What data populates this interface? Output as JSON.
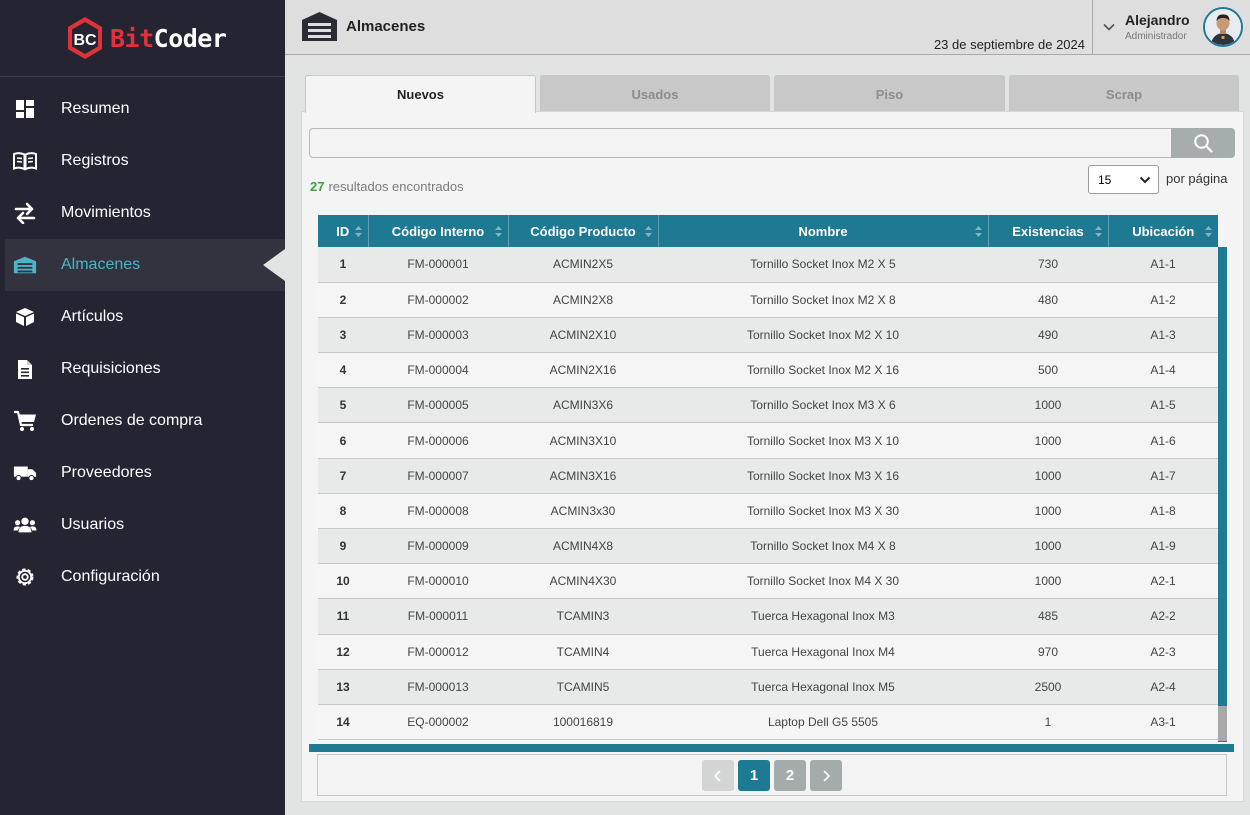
{
  "brand": {
    "part1": "Bit",
    "part2": "Coder",
    "mark": "BC"
  },
  "sidebar": {
    "items": [
      {
        "label": "Resumen",
        "icon": "dashboard-icon",
        "active": false
      },
      {
        "label": "Registros",
        "icon": "book-icon",
        "active": false
      },
      {
        "label": "Movimientos",
        "icon": "exchange-arrows-icon",
        "active": false
      },
      {
        "label": "Almacenes",
        "icon": "warehouse-icon",
        "active": true
      },
      {
        "label": "Artículos",
        "icon": "box-icon",
        "active": false
      },
      {
        "label": "Requisiciones",
        "icon": "document-icon",
        "active": false
      },
      {
        "label": "Ordenes de compra",
        "icon": "cart-icon",
        "active": false
      },
      {
        "label": "Proveedores",
        "icon": "truck-icon",
        "active": false
      },
      {
        "label": "Usuarios",
        "icon": "users-icon",
        "active": false
      },
      {
        "label": "Configuración",
        "icon": "gear-icon",
        "active": false
      }
    ]
  },
  "header": {
    "title": "Almacenes",
    "date": "23 de septiembre de 2024",
    "user": {
      "name": "Alejandro",
      "role": "Administrador"
    }
  },
  "tabs": [
    {
      "label": "Nuevos",
      "active": true
    },
    {
      "label": "Usados",
      "active": false
    },
    {
      "label": "Piso",
      "active": false
    },
    {
      "label": "Scrap",
      "active": false
    }
  ],
  "search": {
    "value": "",
    "placeholder": ""
  },
  "results": {
    "count": "27",
    "text": "resultados encontrados"
  },
  "per_page": {
    "value": "15",
    "label": "por página",
    "options": [
      "15"
    ]
  },
  "table": {
    "columns": [
      "ID",
      "Código Interno",
      "Código Producto",
      "Nombre",
      "Existencias",
      "Ubicación"
    ],
    "rows": [
      [
        "1",
        "FM-000001",
        "ACMIN2X5",
        "Tornillo Socket Inox M2 X 5",
        "730",
        "A1-1"
      ],
      [
        "2",
        "FM-000002",
        "ACMIN2X8",
        "Tornillo Socket Inox M2 X 8",
        "480",
        "A1-2"
      ],
      [
        "3",
        "FM-000003",
        "ACMIN2X10",
        "Tornillo Socket Inox M2 X 10",
        "490",
        "A1-3"
      ],
      [
        "4",
        "FM-000004",
        "ACMIN2X16",
        "Tornillo Socket Inox M2 X 16",
        "500",
        "A1-4"
      ],
      [
        "5",
        "FM-000005",
        "ACMIN3X6",
        "Tornillo Socket Inox M3 X 6",
        "1000",
        "A1-5"
      ],
      [
        "6",
        "FM-000006",
        "ACMIN3X10",
        "Tornillo Socket Inox M3 X 10",
        "1000",
        "A1-6"
      ],
      [
        "7",
        "FM-000007",
        "ACMIN3X16",
        "Tornillo Socket Inox M3 X 16",
        "1000",
        "A1-7"
      ],
      [
        "8",
        "FM-000008",
        "ACMIN3x30",
        "Tornillo Socket Inox M3 X 30",
        "1000",
        "A1-8"
      ],
      [
        "9",
        "FM-000009",
        "ACMIN4X8",
        "Tornillo Socket Inox M4 X 8",
        "1000",
        "A1-9"
      ],
      [
        "10",
        "FM-000010",
        "ACMIN4X30",
        "Tornillo Socket Inox M4 X 30",
        "1000",
        "A2-1"
      ],
      [
        "11",
        "FM-000011",
        "TCAMIN3",
        "Tuerca Hexagonal Inox M3",
        "485",
        "A2-2"
      ],
      [
        "12",
        "FM-000012",
        "TCAMIN4",
        "Tuerca Hexagonal Inox M4",
        "970",
        "A2-3"
      ],
      [
        "13",
        "FM-000013",
        "TCAMIN5",
        "Tuerca Hexagonal Inox M5",
        "2500",
        "A2-4"
      ],
      [
        "14",
        "EQ-000002",
        "100016819",
        "Laptop Dell G5 5505",
        "1",
        "A3-1"
      ]
    ]
  },
  "pagination": {
    "pages": [
      "1",
      "2"
    ],
    "current": "1",
    "prev_icon": "chevron-left-icon",
    "next_icon": "chevron-right-icon"
  },
  "colors": {
    "sidebar_bg": "#252433",
    "accent": "#1d7a92",
    "active_text": "#4cb3c8",
    "brand_red": "#e03338",
    "count_green": "#3ca33c"
  }
}
